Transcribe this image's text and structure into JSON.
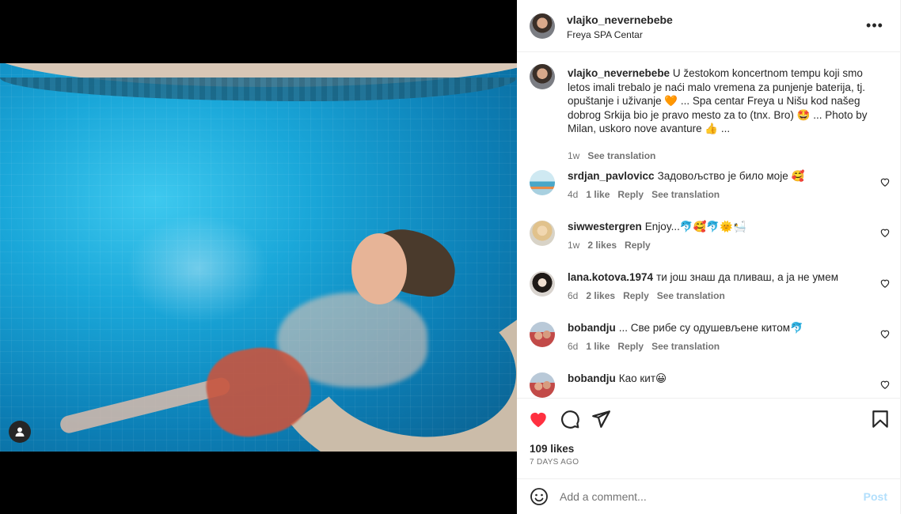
{
  "post": {
    "username": "vlajko_nevernebebe",
    "location": "Freya SPA Centar",
    "caption": "U žestokom koncertnom tempu koji smo letos imali trebalo je naći malo vremena za punjenje baterija, tj. opuštanje i uživanje 🧡 ... Spa centar Freya u Nišu kod našeg dobrog Srkija bio je pravo mesto za to (tnx. Bro) 🤩 ... Photo by Milan, uskoro nove avanture 👍 ...",
    "caption_age": "1w",
    "see_translation": "See translation"
  },
  "comments": [
    {
      "username": "srdjan_pavlovicc",
      "text": "Задовољство је било моје 🥰",
      "age": "4d",
      "likes": "1 like",
      "reply": "Reply",
      "translate": "See translation"
    },
    {
      "username": "siwwestergren",
      "text": "Enjoy...🐬🥰🐬🌞🛀",
      "age": "1w",
      "likes": "2 likes",
      "reply": "Reply",
      "translate": ""
    },
    {
      "username": "lana.kotova.1974",
      "text": "ти још знаш да пливаш, а ја не умем",
      "age": "6d",
      "likes": "2 likes",
      "reply": "Reply",
      "translate": "See translation"
    },
    {
      "username": "bobandju",
      "text": "... Све рибе су одушевљене китом🐬",
      "age": "6d",
      "likes": "1 like",
      "reply": "Reply",
      "translate": "See translation"
    },
    {
      "username": "bobandju",
      "text": "Као кит😀",
      "age": "",
      "likes": "",
      "reply": "",
      "translate": ""
    }
  ],
  "stats": {
    "likes": "109 likes",
    "time_ago": "7 DAYS AGO"
  },
  "add_comment": {
    "placeholder": "Add a comment...",
    "post_label": "Post"
  },
  "icons": {
    "like": "heart-filled-icon",
    "comment": "comment-icon",
    "share": "share-icon",
    "save": "bookmark-icon",
    "emoji": "emoji-icon",
    "more": "more-options-icon",
    "tag": "user-tag-icon"
  },
  "colors": {
    "like_red": "#ff3040",
    "post_disabled": "#b2dffc",
    "secondary_text": "#737373"
  }
}
